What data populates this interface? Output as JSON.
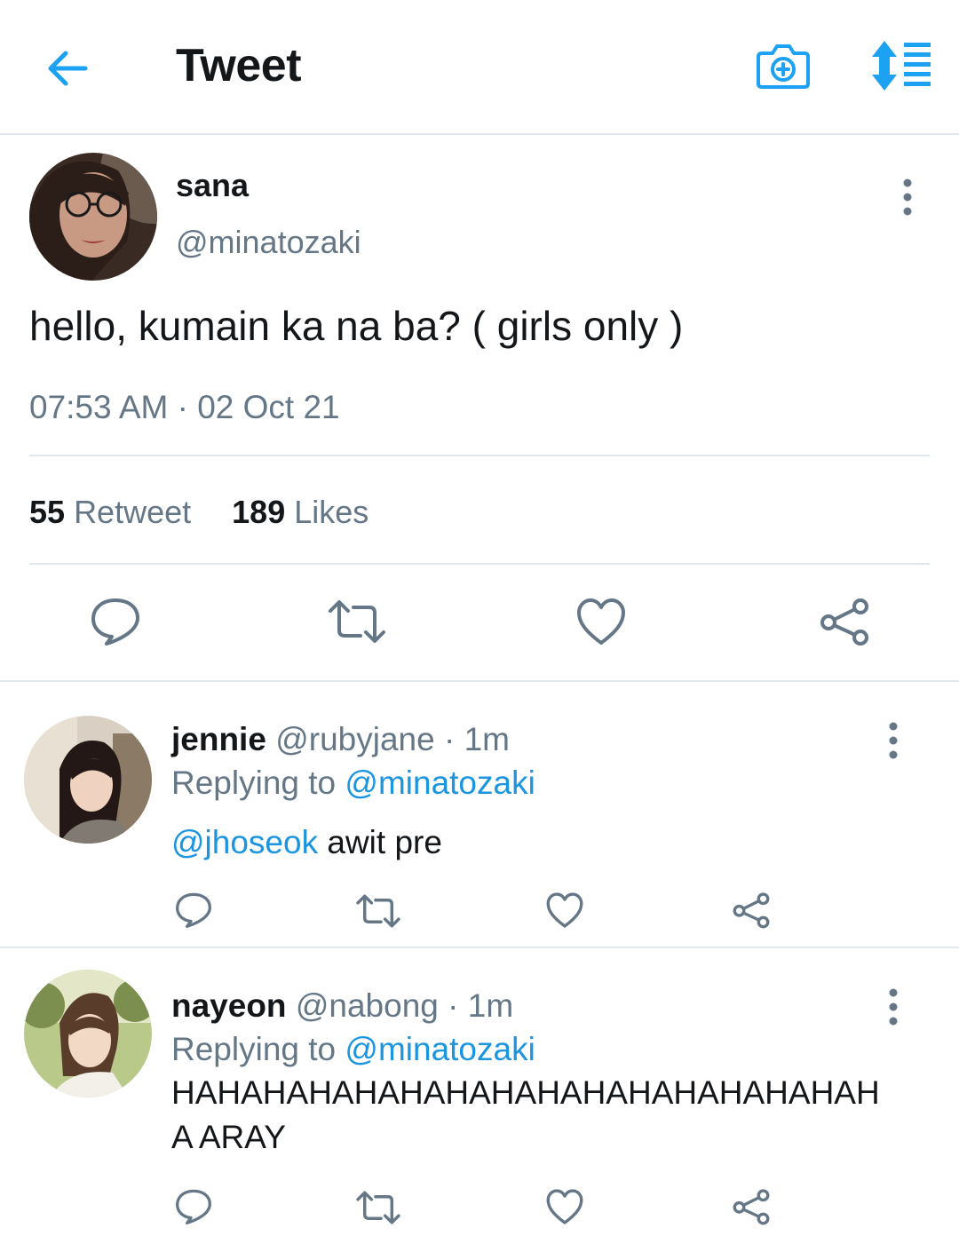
{
  "header": {
    "title": "Tweet",
    "back_icon": "arrow-left-icon",
    "camera_icon": "camera-plus-icon",
    "sort_icon": "sort-list-icon",
    "accent_color": "#1da1f2"
  },
  "tweet": {
    "name": "sana",
    "handle": "@minatozaki",
    "text": "hello, kumain ka na ba? ( girls only )",
    "timestamp": "07:53 AM · 02 Oct 21",
    "retweet_count": "55",
    "retweet_label": "Retweet",
    "likes_count": "189",
    "likes_label": "Likes"
  },
  "replies": [
    {
      "name": "jennie",
      "handle": "@rubyjane",
      "time": "· 1m",
      "replying_prefix": "Replying to",
      "replying_to": "@minatozaki",
      "mention": "@jhoseok",
      "text": " awit pre"
    },
    {
      "name": "nayeon",
      "handle": "@nabong",
      "time": "· 1m",
      "replying_prefix": "Replying to",
      "replying_to": "@minatozaki",
      "text": "HAHAHAHAHAHAHAHAHAHAHAHAHAHAHAHA ARAY"
    }
  ],
  "colors": {
    "text": "#14171a",
    "secondary": "#657786",
    "link": "#1b95e0",
    "divider": "#e1e8ed"
  }
}
